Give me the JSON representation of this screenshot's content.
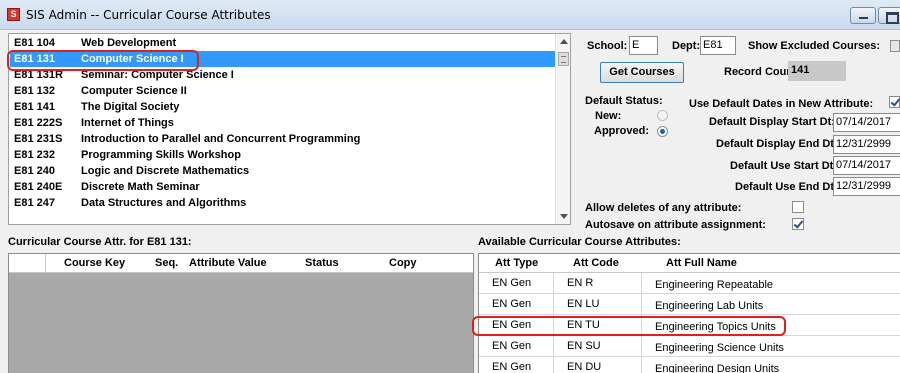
{
  "window": {
    "title": "SIS Admin -- Curricular Course Attributes"
  },
  "course_list": [
    {
      "code": "E81 104",
      "name": "Web Development"
    },
    {
      "code": "E81 131",
      "name": "Computer Science I"
    },
    {
      "code": "E81 131R",
      "name": "Seminar: Computer Science I"
    },
    {
      "code": "E81 132",
      "name": "Computer Science II"
    },
    {
      "code": "E81 141",
      "name": "The Digital Society"
    },
    {
      "code": "E81 222S",
      "name": "Internet of Things"
    },
    {
      "code": "E81 231S",
      "name": "Introduction to Parallel and Concurrent Programming"
    },
    {
      "code": "E81 232",
      "name": "Programming Skills Workshop"
    },
    {
      "code": "E81 240",
      "name": "Logic and Discrete Mathematics"
    },
    {
      "code": "E81 240E",
      "name": "Discrete Math Seminar"
    },
    {
      "code": "E81 247",
      "name": "Data Structures and Algorithms"
    }
  ],
  "filters": {
    "school_label": "School:",
    "school_value": "E",
    "dept_label": "Dept:",
    "dept_value": "E81",
    "show_excluded_label": "Show Excluded Courses:",
    "get_courses_label": "Get Courses",
    "record_count_label": "Record Count:",
    "record_count_value": "141"
  },
  "defaults": {
    "status_label": "Default Status:",
    "new_label": "New:",
    "approved_label": "Approved:",
    "use_default_dates_label": "Use Default Dates in New Attribute:",
    "display_start_label": "Default Display Start Dt:",
    "display_start_value": "07/14/2017",
    "display_end_label": "Default Display End Dt:",
    "display_end_value": "12/31/2999",
    "use_start_label": "Default Use Start Dt:",
    "use_start_value": "07/14/2017",
    "use_end_label": "Default Use End Dt:",
    "use_end_value": "12/31/2999",
    "allow_deletes_label": "Allow deletes of any attribute:",
    "autosave_label": "Autosave on attribute assignment:"
  },
  "course_attrs": {
    "section_label": "Curricular Course Attr. for E81 131:",
    "columns": [
      "Course Key",
      "Seq.",
      "Attribute Value",
      "Status",
      "Copy"
    ]
  },
  "available_attrs": {
    "section_label": "Available Curricular Course Attributes:",
    "columns": [
      "Att Type",
      "Att Code",
      "Att Full Name"
    ],
    "rows": [
      {
        "type": "EN Gen",
        "code": "EN R",
        "name": "Engineering Repeatable"
      },
      {
        "type": "EN Gen",
        "code": "EN LU",
        "name": "Engineering Lab Units"
      },
      {
        "type": "EN Gen",
        "code": "EN TU",
        "name": "Engineering Topics Units"
      },
      {
        "type": "EN Gen",
        "code": "EN SU",
        "name": "Engineering Science Units"
      },
      {
        "type": "EN Gen",
        "code": "EN DU",
        "name": "Engineering Design Units"
      }
    ]
  },
  "colors": {
    "selection": "#3399ff",
    "annotation": "#e0201e",
    "titlebar": "#dfeaf6"
  }
}
